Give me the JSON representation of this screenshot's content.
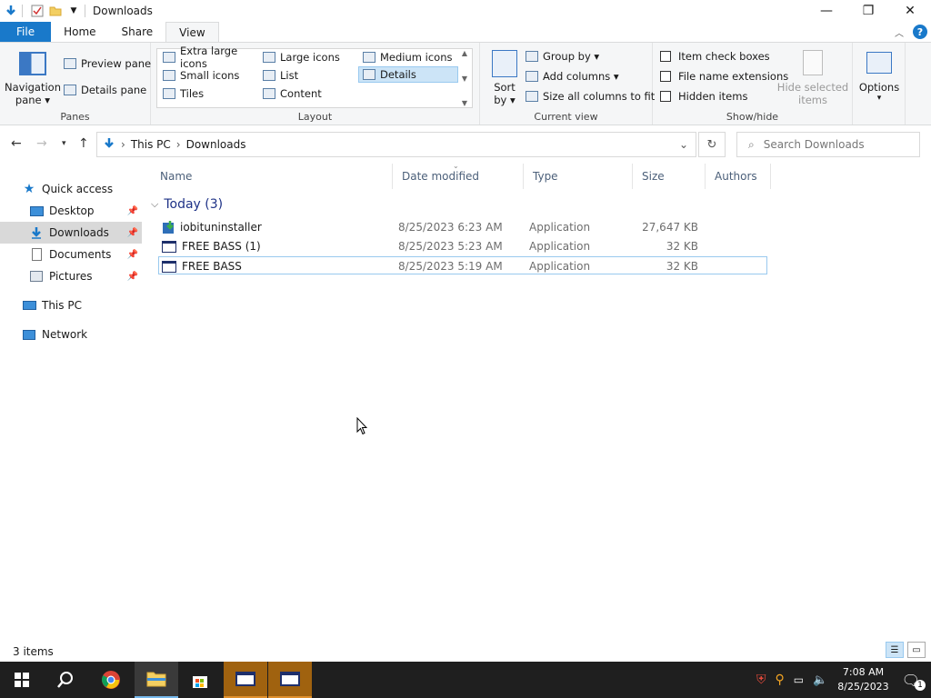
{
  "window": {
    "title": "Downloads"
  },
  "tabs": {
    "file": "File",
    "home": "Home",
    "share": "Share",
    "view": "View"
  },
  "ribbon": {
    "panes": {
      "label": "Panes",
      "navigation_pane": "Navigation",
      "navigation_pane_2": "pane",
      "preview_pane": "Preview pane",
      "details_pane": "Details pane"
    },
    "layout": {
      "label": "Layout",
      "items": [
        "Extra large icons",
        "Large icons",
        "Medium icons",
        "Small icons",
        "List",
        "Details",
        "Tiles",
        "Content"
      ],
      "selected": "Details"
    },
    "current_view": {
      "label": "Current view",
      "sort_by": "Sort",
      "sort_by_2": "by",
      "group_by": "Group by",
      "add_columns": "Add columns",
      "size_all": "Size all columns to fit"
    },
    "show_hide": {
      "label": "Show/hide",
      "item_check_boxes": "Item check boxes",
      "file_name_extensions": "File name extensions",
      "hidden_items": "Hidden items",
      "hide_selected": "Hide selected",
      "hide_selected_2": "items"
    },
    "options": {
      "label": "Options"
    }
  },
  "address": {
    "crumbs": [
      "This PC",
      "Downloads"
    ],
    "search_placeholder": "Search Downloads"
  },
  "nav": {
    "quick_access": "Quick access",
    "desktop": "Desktop",
    "downloads": "Downloads",
    "documents": "Documents",
    "pictures": "Pictures",
    "this_pc": "This PC",
    "network": "Network"
  },
  "columns": {
    "name": "Name",
    "date": "Date modified",
    "type": "Type",
    "size": "Size",
    "authors": "Authors"
  },
  "group": {
    "title": "Today (3)"
  },
  "files": [
    {
      "name": "iobituninstaller",
      "date": "8/25/2023 6:23 AM",
      "type": "Application",
      "size": "27,647 KB"
    },
    {
      "name": "FREE BASS (1)",
      "date": "8/25/2023 5:23 AM",
      "type": "Application",
      "size": "32 KB"
    },
    {
      "name": "FREE BASS",
      "date": "8/25/2023 5:19 AM",
      "type": "Application",
      "size": "32 KB"
    }
  ],
  "status": {
    "count": "3 items"
  },
  "taskbar": {
    "time": "7:08 AM",
    "date": "8/25/2023",
    "notifications": "1"
  },
  "colors": {
    "accent": "#1979ca",
    "taskbar": "#1f1f1f",
    "selection": "#cce4f7",
    "group_title": "#1e3287"
  }
}
